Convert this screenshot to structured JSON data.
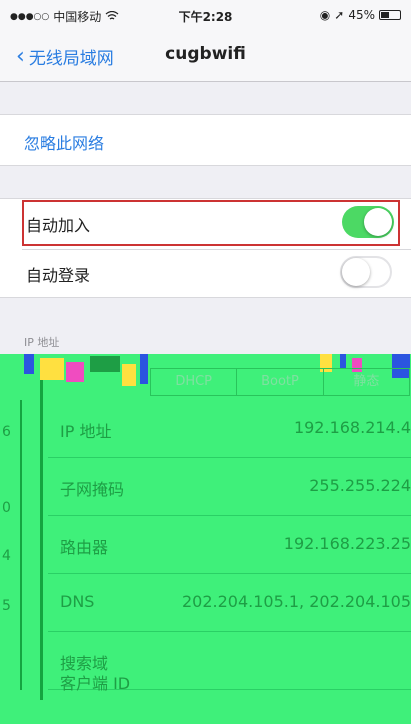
{
  "status": {
    "carrier": "中国移动",
    "time": "下午2:28",
    "battery": "45%",
    "battery_level": 0.45
  },
  "nav": {
    "back_label": "无线局域网",
    "title": "cugbwifi"
  },
  "settings": {
    "forget_label": "忽略此网络",
    "auto_join_label": "自动加入",
    "auto_join_on": true,
    "auto_login_label": "自动登录",
    "auto_login_on": false,
    "ip_section_label": "IP 地址"
  },
  "segmented": {
    "options": [
      "DHCP",
      "BootP",
      "静态"
    ]
  },
  "ip": {
    "rows": [
      {
        "key": "IP 地址",
        "value": "192.168.214.4"
      },
      {
        "key": "子网掩码",
        "value": "255.255.224"
      },
      {
        "key": "路由器",
        "value": "192.168.223.25"
      },
      {
        "key": "DNS",
        "value": "202.204.105.1, 202.204.105"
      },
      {
        "key": "搜索域",
        "value": ""
      },
      {
        "key": "客户端 ID",
        "value": ""
      }
    ]
  },
  "left_fragments": [
    "6",
    "0",
    "4",
    "5"
  ],
  "colors": {
    "accent": "#2a7de1",
    "toggle_on": "#4cd964",
    "overlay": "#3ff07a"
  }
}
